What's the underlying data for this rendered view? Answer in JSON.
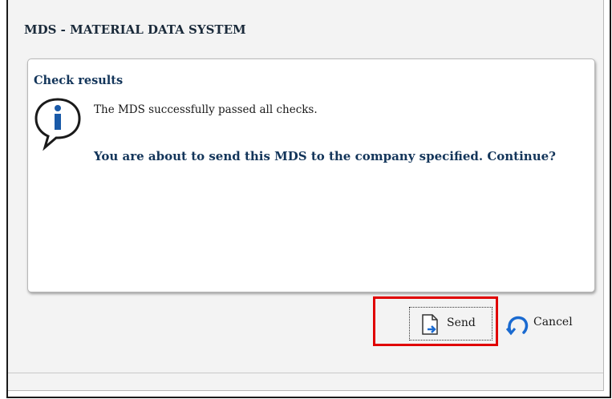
{
  "dialog": {
    "title": "MDS - MATERIAL DATA SYSTEM",
    "panel": {
      "title": "Check results",
      "icon": "info-icon",
      "message": "The MDS successfully passed all checks.",
      "prompt": "You are about to send this MDS to the company specified. Continue?"
    },
    "buttons": {
      "send_label": "Send",
      "send_icon": "document-send-icon",
      "cancel_label": "Cancel",
      "cancel_icon": "undo-icon"
    }
  },
  "colors": {
    "title_text": "#1a2a3a",
    "heading_text": "#13355a",
    "highlight": "#e00000",
    "dialog_bg": "#f3f3f3"
  }
}
